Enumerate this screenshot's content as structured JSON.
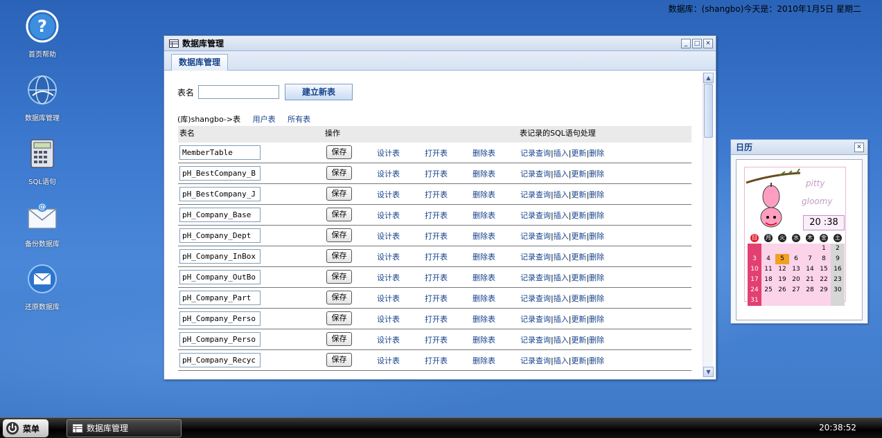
{
  "top_status": "数据库：(shangbo)今天是：2010年1月5日 星期二",
  "desktop_icons": [
    {
      "label": "首页帮助",
      "icon": "help-icon"
    },
    {
      "label": "数据库管理",
      "icon": "database-globe-icon"
    },
    {
      "label": "SQL语句",
      "icon": "calculator-icon"
    },
    {
      "label": "备份数据库",
      "icon": "mail-at-icon"
    },
    {
      "label": "还原数据库",
      "icon": "envelope-icon"
    }
  ],
  "window": {
    "title": "数据库管理",
    "tab": "数据库管理",
    "new_table": {
      "label": "表名",
      "input_value": "",
      "button": "建立新表"
    },
    "filter": {
      "prefix": "(库)shangbo->表",
      "user_tables": "用户表",
      "all_tables": "所有表"
    },
    "grid": {
      "headers": {
        "name": "表名",
        "ops": "操作",
        "sql": "表记录的SQL语句处理"
      },
      "save_label": "保存",
      "design_label": "设计表",
      "open_label": "打开表",
      "delete_label": "删除表",
      "sql_ops": [
        "记录查询",
        "插入",
        "更新",
        "删除"
      ],
      "sql_sep": "|",
      "rows": [
        "MemberTable",
        "pH_BestCompany_B",
        "pH_BestCompany_J",
        "pH_Company_Base",
        "pH_Company_Dept",
        "pH_Company_InBox",
        "pH_Company_OutBo",
        "pH_Company_Part",
        "pH_Company_Perso",
        "pH_Company_Perso",
        "pH_Company_Recyc"
      ]
    }
  },
  "calendar": {
    "title": "日历",
    "brand": "pitty gloomy",
    "brand_line1": "pitty",
    "brand_line2": "gloomy",
    "clock_hour": "20",
    "clock_min": "38",
    "dow": [
      "日",
      "月",
      "火",
      "水",
      "木",
      "金",
      "土"
    ],
    "month_days": [
      "",
      "",
      "",
      "",
      "",
      "1",
      "2",
      "3",
      "4",
      "5",
      "6",
      "7",
      "8",
      "9",
      "10",
      "11",
      "12",
      "13",
      "14",
      "15",
      "16",
      "17",
      "18",
      "19",
      "20",
      "21",
      "22",
      "23",
      "24",
      "25",
      "26",
      "27",
      "28",
      "29",
      "30",
      "31",
      "",
      "",
      "",
      "",
      "",
      ""
    ],
    "today": "5"
  },
  "taskbar": {
    "start_label": "菜单",
    "task_label": "数据库管理",
    "clock": "20:38:52"
  }
}
